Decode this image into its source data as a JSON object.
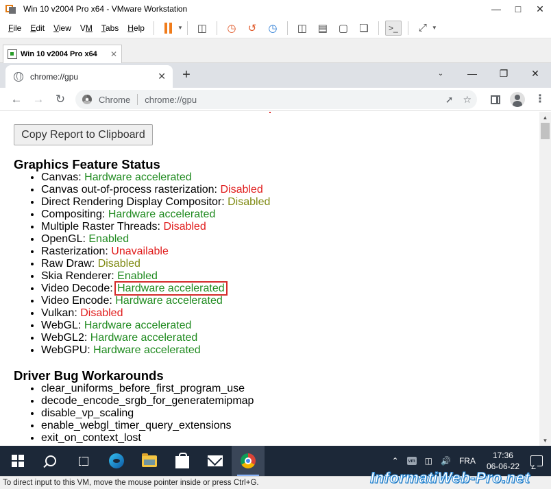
{
  "vmware": {
    "window_title": "Win 10 v2004 Pro x64 - VMware Workstation",
    "menus": [
      "File",
      "Edit",
      "View",
      "VM",
      "Tabs",
      "Help"
    ],
    "menu_underline": [
      "F",
      "E",
      "V",
      "M",
      "T",
      "H"
    ],
    "vm_tab_label": "Win 10 v2004 Pro x64",
    "status_text": "To direct input to this VM, move the mouse pointer inside or press Ctrl+G."
  },
  "chrome": {
    "tab_title": "chrome://gpu",
    "omnibox_label": "Chrome",
    "omnibox_url": "chrome://gpu"
  },
  "page": {
    "copy_button": "Copy Report to Clipboard",
    "graphics_title": "Graphics Feature Status",
    "features": [
      {
        "name": "Canvas: ",
        "status": "Hardware accelerated",
        "color": "#1f8a1f"
      },
      {
        "name": "Canvas out-of-process rasterization: ",
        "status": "Disabled",
        "color": "#e01b1b"
      },
      {
        "name": "Direct Rendering Display Compositor: ",
        "status": "Disabled",
        "color": "#7f8a12"
      },
      {
        "name": "Compositing: ",
        "status": "Hardware accelerated",
        "color": "#1f8a1f"
      },
      {
        "name": "Multiple Raster Threads: ",
        "status": "Disabled",
        "color": "#e01b1b"
      },
      {
        "name": "OpenGL: ",
        "status": "Enabled",
        "color": "#1f8a1f"
      },
      {
        "name": "Rasterization: ",
        "status": "Unavailable",
        "color": "#e01b1b"
      },
      {
        "name": "Raw Draw: ",
        "status": "Disabled",
        "color": "#7f8a12"
      },
      {
        "name": "Skia Renderer: ",
        "status": "Enabled",
        "color": "#1f8a1f"
      },
      {
        "name": "Video Decode: ",
        "status": "Hardware accelerated",
        "color": "#1f8a1f",
        "highlighted": true
      },
      {
        "name": "Video Encode: ",
        "status": "Hardware accelerated",
        "color": "#1f8a1f"
      },
      {
        "name": "Vulkan: ",
        "status": "Disabled",
        "color": "#e01b1b"
      },
      {
        "name": "WebGL: ",
        "status": "Hardware accelerated",
        "color": "#1f8a1f"
      },
      {
        "name": "WebGL2: ",
        "status": "Hardware accelerated",
        "color": "#1f8a1f"
      },
      {
        "name": "WebGPU: ",
        "status": "Hardware accelerated",
        "color": "#1f8a1f"
      }
    ],
    "workarounds_title": "Driver Bug Workarounds",
    "workarounds": [
      "clear_uniforms_before_first_program_use",
      "decode_encode_srgb_for_generatemipmap",
      "disable_vp_scaling",
      "enable_webgl_timer_query_extensions",
      "exit_on_context_lost"
    ]
  },
  "taskbar": {
    "language": "FRA",
    "time": "17:36",
    "date": "06-06-22",
    "vm_tray_label": "vm"
  },
  "watermark": "InformatiWeb-Pro.net"
}
